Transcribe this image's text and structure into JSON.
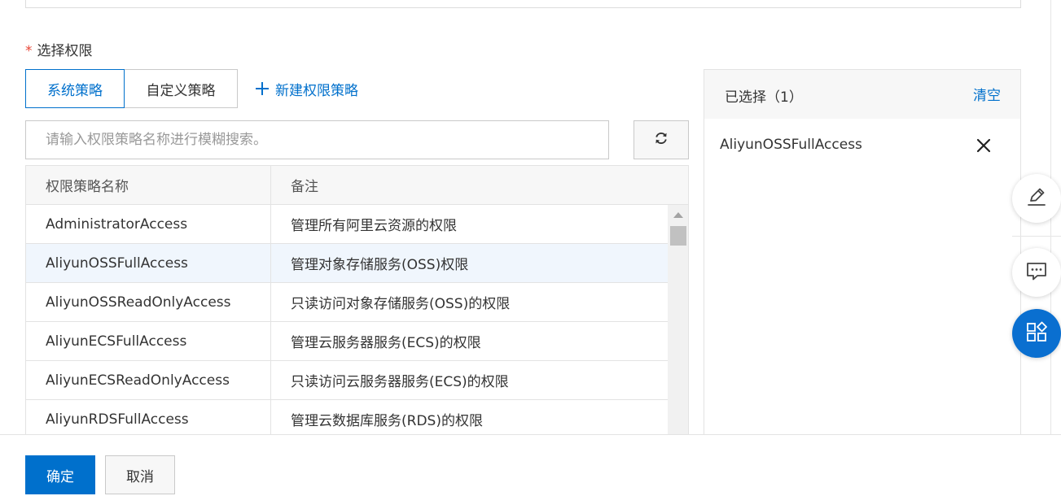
{
  "permission_section": {
    "required_mark": "*",
    "label": "选择权限"
  },
  "tabs": [
    {
      "label": "系统策略",
      "active": true
    },
    {
      "label": "自定义策略",
      "active": false
    }
  ],
  "new_policy_link": "新建权限策略",
  "search": {
    "placeholder": "请输入权限策略名称进行模糊搜索。",
    "value": ""
  },
  "table": {
    "columns": [
      "权限策略名称",
      "备注"
    ],
    "rows": [
      {
        "name": "AdministratorAccess",
        "note": "管理所有阿里云资源的权限",
        "selected": false
      },
      {
        "name": "AliyunOSSFullAccess",
        "note": "管理对象存储服务(OSS)权限",
        "selected": true
      },
      {
        "name": "AliyunOSSReadOnlyAccess",
        "note": "只读访问对象存储服务(OSS)的权限",
        "selected": false
      },
      {
        "name": "AliyunECSFullAccess",
        "note": "管理云服务器服务(ECS)的权限",
        "selected": false
      },
      {
        "name": "AliyunECSReadOnlyAccess",
        "note": "只读访问云服务器服务(ECS)的权限",
        "selected": false
      },
      {
        "name": "AliyunRDSFullAccess",
        "note": "管理云数据库服务(RDS)的权限",
        "selected": false
      }
    ]
  },
  "selected_panel": {
    "title": "已选择（1）",
    "clear_label": "清空",
    "items": [
      "AliyunOSSFullAccess"
    ]
  },
  "footer": {
    "confirm_label": "确定",
    "cancel_label": "取消"
  },
  "colors": {
    "accent": "#0070cc",
    "selected_row_bg": "#f0f6fd",
    "required": "#e84738"
  },
  "icons": {
    "refresh": "refresh-icon",
    "plus": "plus-icon",
    "close": "close-icon",
    "edit": "edit-icon",
    "chat": "chat-icon",
    "apps": "apps-icon"
  }
}
